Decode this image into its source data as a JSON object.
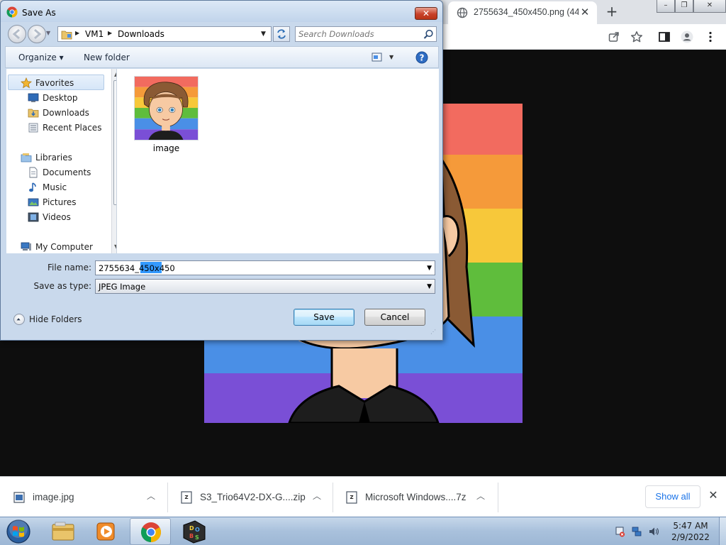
{
  "browser": {
    "tab_title": "2755634_450x450.png (44",
    "tab_close": "✕",
    "new_tab": "+",
    "window_controls": {
      "minimize": "–",
      "restore": "❐",
      "close": "✕"
    }
  },
  "dialog": {
    "title": "Save As",
    "close_glyph": "✕",
    "breadcrumb": [
      "VM1",
      "Downloads"
    ],
    "search_placeholder": "Search Downloads",
    "organize_label": "Organize ▾",
    "new_folder_label": "New folder",
    "navigation": {
      "favorites": "Favorites",
      "favorites_items": [
        "Desktop",
        "Downloads",
        "Recent Places"
      ],
      "libraries": "Libraries",
      "libraries_items": [
        "Documents",
        "Music",
        "Pictures",
        "Videos"
      ],
      "computer": "My Computer"
    },
    "file_item": "image",
    "file_name_label": "File name:",
    "file_name_value": "2755634_450x450",
    "save_type_label": "Save as type:",
    "save_type_value": "JPEG Image",
    "hide_folders_label": "Hide Folders",
    "save_button": "Save",
    "cancel_button": "Cancel"
  },
  "downloads": {
    "items": [
      {
        "name": "image.jpg"
      },
      {
        "name": "S3_Trio64V2-DX-G....zip"
      },
      {
        "name": "Microsoft Windows....7z"
      }
    ],
    "show_all": "Show all",
    "close_glyph": "✕"
  },
  "taskbar": {
    "time": "5:47 AM",
    "date": "2/9/2022"
  },
  "colors": {
    "rainbow": [
      "#f26b5f",
      "#f59a3a",
      "#f7c83a",
      "#5fbd3c",
      "#4a8fe6",
      "#7a4fd6"
    ],
    "link_blue": "#1a73e8",
    "selection_blue": "#3399ff"
  }
}
